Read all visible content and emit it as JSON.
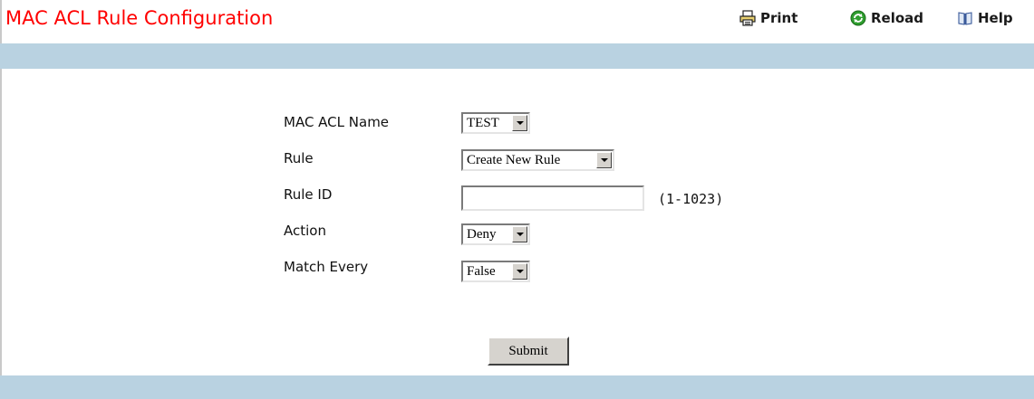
{
  "header": {
    "title": "MAC ACL Rule Configuration",
    "title_color": "#ff0000",
    "print_label": "Print",
    "print_icon": "printer-icon",
    "reload_label": "Reload",
    "reload_icon": "reload-icon",
    "help_label": "Help",
    "help_icon": "book-icon"
  },
  "band_color": "#b9d2e1",
  "form": {
    "acl_name": {
      "label": "MAC ACL Name",
      "value": "TEST"
    },
    "rule": {
      "label": "Rule",
      "value": "Create New Rule"
    },
    "rule_id": {
      "label": "Rule ID",
      "value": "",
      "hint": "(1-1023)"
    },
    "action": {
      "label": "Action",
      "value": "Deny"
    },
    "match_every": {
      "label": "Match Every",
      "value": "False"
    },
    "submit_label": "Submit"
  }
}
